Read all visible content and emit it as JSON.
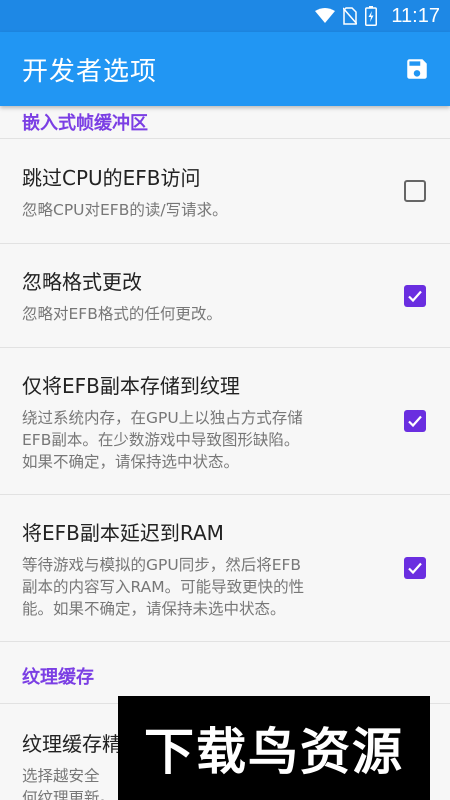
{
  "status_bar": {
    "time": "11:17",
    "icons": [
      "wifi-icon",
      "no-sim-icon",
      "battery-charging-icon"
    ]
  },
  "app_bar": {
    "title": "开发者选项",
    "action_icon": "save-icon"
  },
  "sections": {
    "efb": {
      "header": "嵌入式帧缓冲区"
    },
    "texture": {
      "header": "纹理缓存"
    }
  },
  "settings": [
    {
      "title": "跳过CPU的EFB访问",
      "desc": [
        "忽略CPU对EFB的读/写请求。"
      ],
      "checked": false
    },
    {
      "title": "忽略格式更改",
      "desc": [
        "忽略对EFB格式的任何更改。"
      ],
      "checked": true
    },
    {
      "title": "仅将EFB副本存储到纹理",
      "desc": [
        "绕过系统内存，在GPU上以独占方式存储",
        "EFB副本。在少数游戏中导致图形缺陷。",
        "如果不确定，请保持选中状态。"
      ],
      "checked": true
    },
    {
      "title": "将EFB副本延迟到RAM",
      "desc": [
        "等待游戏与模拟的GPU同步，然后将EFB",
        "副本的内容写入RAM。可能导致更快的性",
        "能。如果不确定，请保持未选中状态。"
      ],
      "checked": true
    },
    {
      "title": "纹理缓存精",
      "desc": [
        "选择越安全",
        "何纹理更新。"
      ]
    }
  ],
  "watermark": {
    "text": "下载鸟资源"
  },
  "colors": {
    "primary": "#2196f3",
    "primary_dark": "#1e88e5",
    "accent": "#6a2ee0",
    "section_header": "#7b3fe4"
  }
}
